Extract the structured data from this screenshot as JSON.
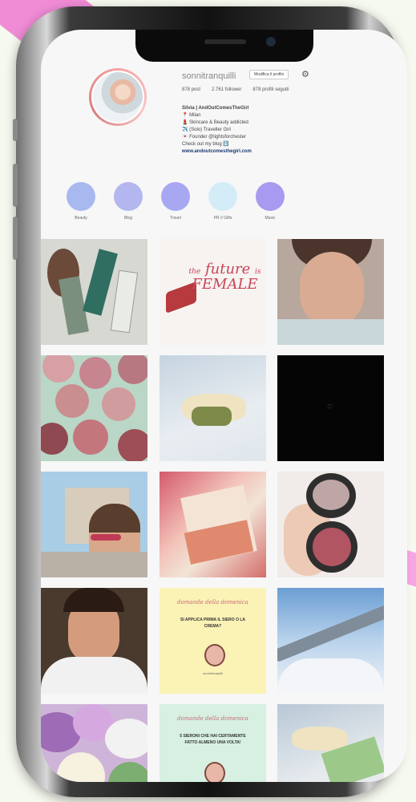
{
  "profile": {
    "username": "sonnitranquilli",
    "edit_label": "Modifica il profilo",
    "posts": "878 post",
    "followers": "2.761 follower",
    "following": "878 profili seguiti",
    "bio": {
      "name": "Silvia | AndOutComesTheGirl",
      "line1": "📍 Milan",
      "line2": "💄 Skincare & Beauty addicted",
      "line3": "✈️ (Solo) Traveller Girl",
      "line4": "💌 Founder @lightsforchester",
      "line5": "Check out my blog ⬇️",
      "link": "www.andoutcomesthegirl.com"
    }
  },
  "highlights": [
    {
      "label": "Beauty",
      "color": "#a7b9ef"
    },
    {
      "label": "Blog",
      "color": "#b3b6ef"
    },
    {
      "label": "Travel",
      "color": "#a8a8f2"
    },
    {
      "label": "PR // Gifts",
      "color": "#d3ecf8"
    },
    {
      "label": "Music",
      "color": "#a89af0"
    }
  ],
  "posts": {
    "future_line1": "the",
    "future_line2": "future",
    "future_line3": "is",
    "future_line4": "FEMALE",
    "quiz1_title": "domande della domenica",
    "quiz1_question": "SI APPLICA PRIMA IL SIERO O LA CREMA?",
    "quiz1_handle": "sonnitranquilli",
    "quiz2_title": "domande della domenica",
    "quiz2_question": "5 SIERONI CHE HAI CERTAMENTE FATTO ALMENO UNA VOLTA!"
  }
}
